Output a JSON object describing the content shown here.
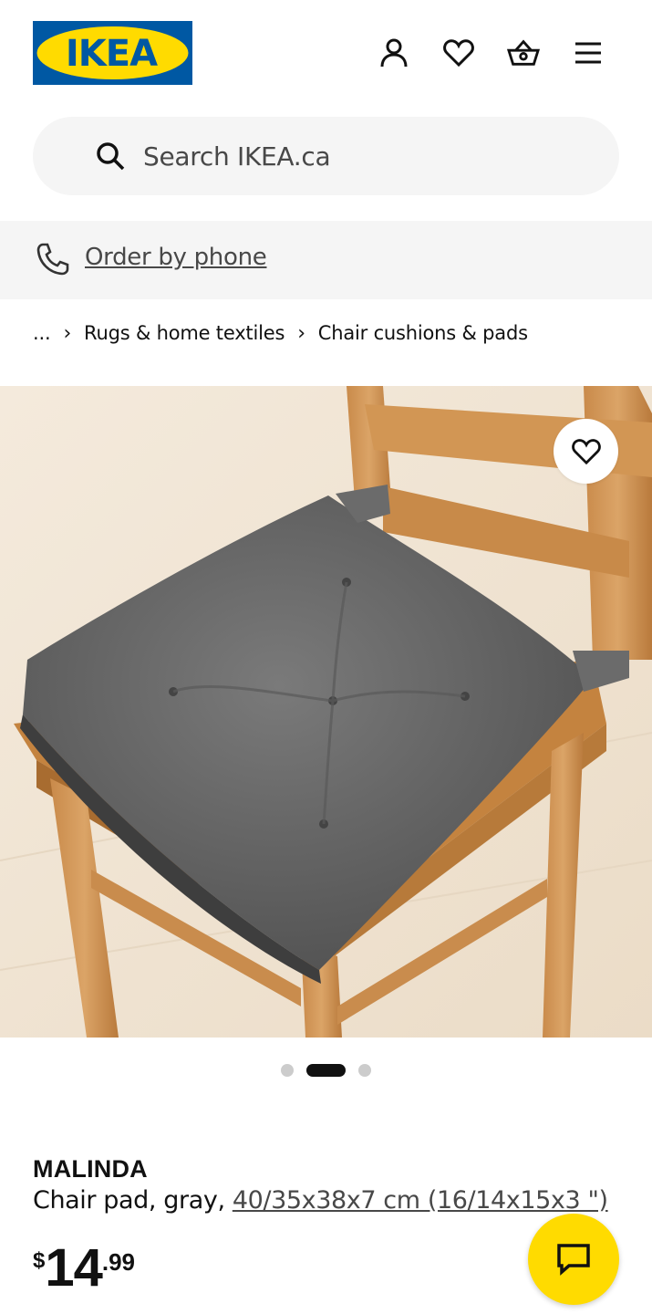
{
  "header": {
    "logo_text": "IKEA",
    "icons": [
      "account-icon",
      "heart-icon",
      "basket-icon",
      "menu-icon"
    ]
  },
  "search": {
    "placeholder": "Search IKEA.ca",
    "icon": "search-icon"
  },
  "phone_bar": {
    "icon": "phone-icon",
    "link_text": "Order by phone"
  },
  "breadcrumb": {
    "items": [
      "...",
      "Rugs & home textiles",
      "Chair cushions & pads"
    ],
    "separator": "›"
  },
  "product": {
    "image_alt": "Gray tufted chair pad on a wooden chair",
    "carousel": {
      "total": 3,
      "active": 2
    },
    "name": "MALINDA",
    "description_prefix": "Chair pad, gray, ",
    "size_link": "40/35x38x7 cm (16/14x15x3 \")",
    "price": {
      "currency": "$",
      "integer": "14",
      "decimal": ".99"
    }
  },
  "colors": {
    "brand_blue": "#0058a3",
    "brand_yellow": "#ffdb00",
    "text": "#111111",
    "muted_bg": "#f5f5f5"
  }
}
